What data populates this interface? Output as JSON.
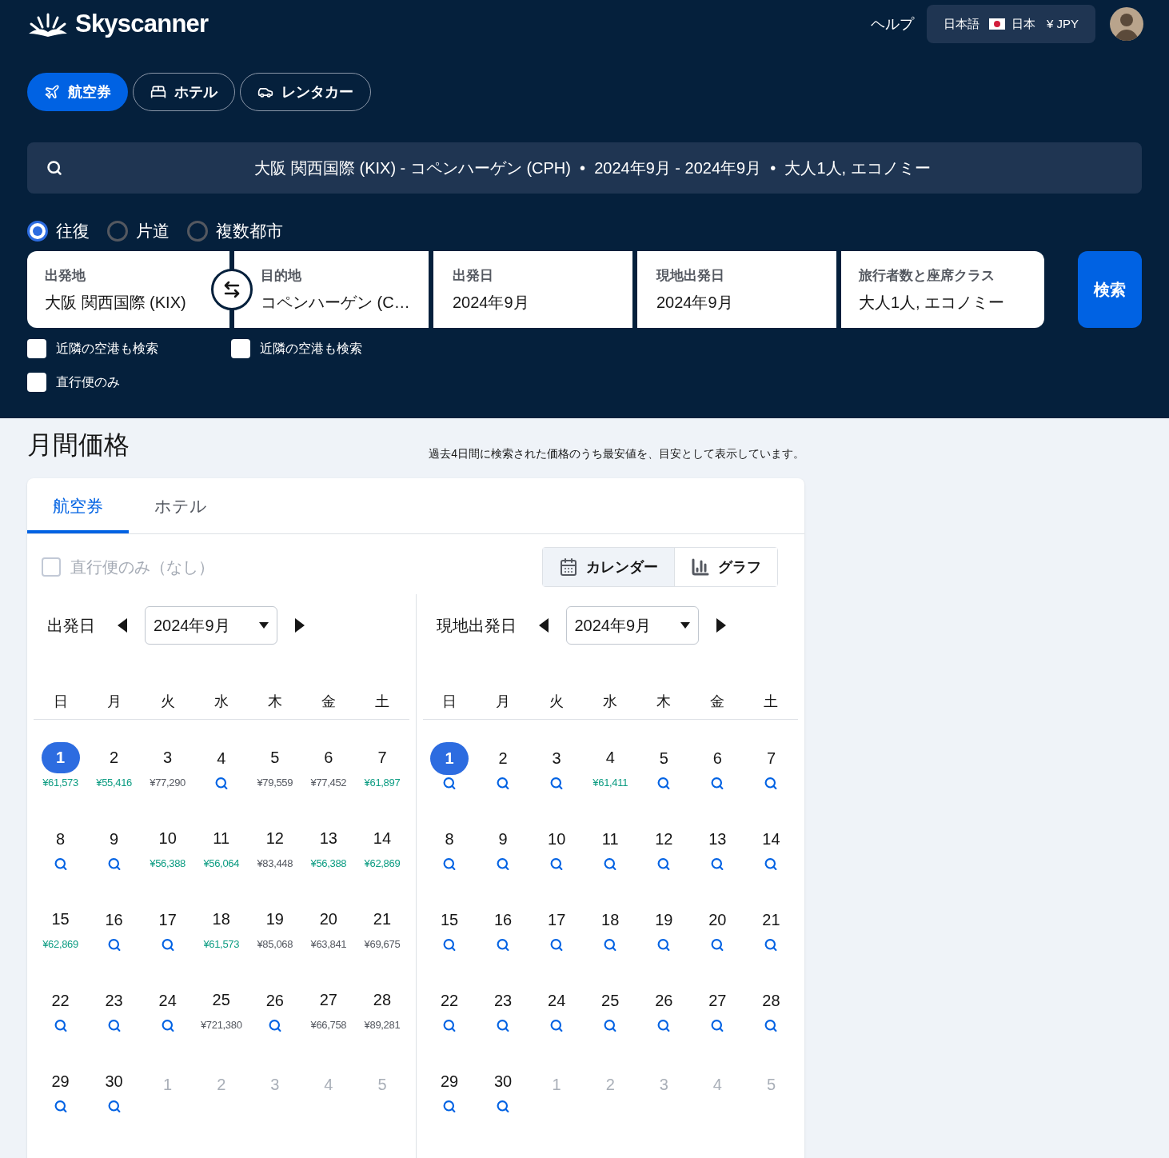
{
  "header": {
    "logo": "Skyscanner",
    "help": "ヘルプ",
    "locale": {
      "language": "日本語",
      "country": "日本",
      "currency": "¥ JPY"
    }
  },
  "product_tabs": [
    {
      "label": "航空券",
      "kind": "flights",
      "selected": true
    },
    {
      "label": "ホテル",
      "kind": "hotels",
      "selected": false
    },
    {
      "label": "レンタカー",
      "kind": "cars",
      "selected": false
    }
  ],
  "search_summary": "大阪 関西国際 (KIX) - コペンハーゲン (CPH)  •  2024年9月 - 2024年9月  •  大人1人, エコノミー",
  "trip_types": [
    {
      "label": "往復",
      "selected": true
    },
    {
      "label": "片道",
      "selected": false
    },
    {
      "label": "複数都市",
      "selected": false
    }
  ],
  "fields": [
    {
      "label": "出発地",
      "value": "大阪 関西国際 (KIX)"
    },
    {
      "label": "目的地",
      "value": "コペンハーゲン (C…"
    },
    {
      "label": "出発日",
      "value": "2024年9月"
    },
    {
      "label": "現地出発日",
      "value": "2024年9月"
    },
    {
      "label": "旅行者数と座席クラス",
      "value": "大人1人, エコノミー"
    }
  ],
  "search_button": "検索",
  "checkboxes": [
    {
      "label": "近隣の空港も検索",
      "checked": false
    },
    {
      "label": "近隣の空港も検索",
      "checked": false
    },
    {
      "label": "直行便のみ",
      "checked": false
    }
  ],
  "monthly": {
    "title": "月間価格",
    "note": "過去4日間に検索された価格のうち最安値を、目安として表示しています。",
    "tabs": [
      {
        "label": "航空券",
        "selected": true
      },
      {
        "label": "ホテル",
        "selected": false
      }
    ],
    "direct_only": {
      "label": "直行便のみ（なし）",
      "checked": false,
      "disabled": true
    },
    "views": [
      {
        "label": "カレンダー",
        "kind": "calendar",
        "selected": true
      },
      {
        "label": "グラフ",
        "kind": "graph",
        "selected": false
      }
    ],
    "calendars": [
      {
        "label": "出発日",
        "month": "2024年9月",
        "weekdays": [
          "日",
          "月",
          "火",
          "水",
          "木",
          "金",
          "土"
        ],
        "days": [
          {
            "day": "1",
            "kind": "price",
            "price": "¥61,573",
            "cheap": true,
            "selected": true
          },
          {
            "day": "2",
            "kind": "price",
            "price": "¥55,416",
            "cheap": true,
            "selected": false
          },
          {
            "day": "3",
            "kind": "price",
            "price": "¥77,290",
            "cheap": false,
            "selected": false
          },
          {
            "day": "4",
            "kind": "search",
            "selected": false
          },
          {
            "day": "5",
            "kind": "price",
            "price": "¥79,559",
            "cheap": false,
            "selected": false
          },
          {
            "day": "6",
            "kind": "price",
            "price": "¥77,452",
            "cheap": false,
            "selected": false
          },
          {
            "day": "7",
            "kind": "price",
            "price": "¥61,897",
            "cheap": true,
            "selected": false
          },
          {
            "day": "8",
            "kind": "search",
            "selected": false
          },
          {
            "day": "9",
            "kind": "search",
            "selected": false
          },
          {
            "day": "10",
            "kind": "price",
            "price": "¥56,388",
            "cheap": true,
            "selected": false
          },
          {
            "day": "11",
            "kind": "price",
            "price": "¥56,064",
            "cheap": true,
            "selected": false
          },
          {
            "day": "12",
            "kind": "price",
            "price": "¥83,448",
            "cheap": false,
            "selected": false
          },
          {
            "day": "13",
            "kind": "price",
            "price": "¥56,388",
            "cheap": true,
            "selected": false
          },
          {
            "day": "14",
            "kind": "price",
            "price": "¥62,869",
            "cheap": true,
            "selected": false
          },
          {
            "day": "15",
            "kind": "price",
            "price": "¥62,869",
            "cheap": true,
            "selected": false
          },
          {
            "day": "16",
            "kind": "search",
            "selected": false
          },
          {
            "day": "17",
            "kind": "search",
            "selected": false
          },
          {
            "day": "18",
            "kind": "price",
            "price": "¥61,573",
            "cheap": true,
            "selected": false
          },
          {
            "day": "19",
            "kind": "price",
            "price": "¥85,068",
            "cheap": false,
            "selected": false
          },
          {
            "day": "20",
            "kind": "price",
            "price": "¥63,841",
            "cheap": false,
            "selected": false
          },
          {
            "day": "21",
            "kind": "price",
            "price": "¥69,675",
            "cheap": false,
            "selected": false
          },
          {
            "day": "22",
            "kind": "search",
            "selected": false
          },
          {
            "day": "23",
            "kind": "search",
            "selected": false
          },
          {
            "day": "24",
            "kind": "search",
            "selected": false
          },
          {
            "day": "25",
            "kind": "price",
            "price": "¥721,380",
            "cheap": false,
            "selected": false
          },
          {
            "day": "26",
            "kind": "search",
            "selected": false
          },
          {
            "day": "27",
            "kind": "price",
            "price": "¥66,758",
            "cheap": false,
            "selected": false
          },
          {
            "day": "28",
            "kind": "price",
            "price": "¥89,281",
            "cheap": false,
            "selected": false
          },
          {
            "day": "29",
            "kind": "search",
            "selected": false
          },
          {
            "day": "30",
            "kind": "search",
            "selected": false
          },
          {
            "day": "1",
            "kind": "outside",
            "selected": false
          },
          {
            "day": "2",
            "kind": "outside",
            "selected": false
          },
          {
            "day": "3",
            "kind": "outside",
            "selected": false
          },
          {
            "day": "4",
            "kind": "outside",
            "selected": false
          },
          {
            "day": "5",
            "kind": "outside",
            "selected": false
          }
        ]
      },
      {
        "label": "現地出発日",
        "month": "2024年9月",
        "weekdays": [
          "日",
          "月",
          "火",
          "水",
          "木",
          "金",
          "土"
        ],
        "days": [
          {
            "day": "1",
            "kind": "search",
            "selected": true
          },
          {
            "day": "2",
            "kind": "search",
            "selected": false
          },
          {
            "day": "3",
            "kind": "search",
            "selected": false
          },
          {
            "day": "4",
            "kind": "price",
            "price": "¥61,411",
            "cheap": true,
            "selected": false
          },
          {
            "day": "5",
            "kind": "search",
            "selected": false
          },
          {
            "day": "6",
            "kind": "search",
            "selected": false
          },
          {
            "day": "7",
            "kind": "search",
            "selected": false
          },
          {
            "day": "8",
            "kind": "search",
            "selected": false
          },
          {
            "day": "9",
            "kind": "search",
            "selected": false
          },
          {
            "day": "10",
            "kind": "search",
            "selected": false
          },
          {
            "day": "11",
            "kind": "search",
            "selected": false
          },
          {
            "day": "12",
            "kind": "search",
            "selected": false
          },
          {
            "day": "13",
            "kind": "search",
            "selected": false
          },
          {
            "day": "14",
            "kind": "search",
            "selected": false
          },
          {
            "day": "15",
            "kind": "search",
            "selected": false
          },
          {
            "day": "16",
            "kind": "search",
            "selected": false
          },
          {
            "day": "17",
            "kind": "search",
            "selected": false
          },
          {
            "day": "18",
            "kind": "search",
            "selected": false
          },
          {
            "day": "19",
            "kind": "search",
            "selected": false
          },
          {
            "day": "20",
            "kind": "search",
            "selected": false
          },
          {
            "day": "21",
            "kind": "search",
            "selected": false
          },
          {
            "day": "22",
            "kind": "search",
            "selected": false
          },
          {
            "day": "23",
            "kind": "search",
            "selected": false
          },
          {
            "day": "24",
            "kind": "search",
            "selected": false
          },
          {
            "day": "25",
            "kind": "search",
            "selected": false
          },
          {
            "day": "26",
            "kind": "search",
            "selected": false
          },
          {
            "day": "27",
            "kind": "search",
            "selected": false
          },
          {
            "day": "28",
            "kind": "search",
            "selected": false
          },
          {
            "day": "29",
            "kind": "search",
            "selected": false
          },
          {
            "day": "30",
            "kind": "search",
            "selected": false
          },
          {
            "day": "1",
            "kind": "outside",
            "selected": false
          },
          {
            "day": "2",
            "kind": "outside",
            "selected": false
          },
          {
            "day": "3",
            "kind": "outside",
            "selected": false
          },
          {
            "day": "4",
            "kind": "outside",
            "selected": false
          },
          {
            "day": "5",
            "kind": "outside",
            "selected": false
          }
        ]
      }
    ]
  }
}
